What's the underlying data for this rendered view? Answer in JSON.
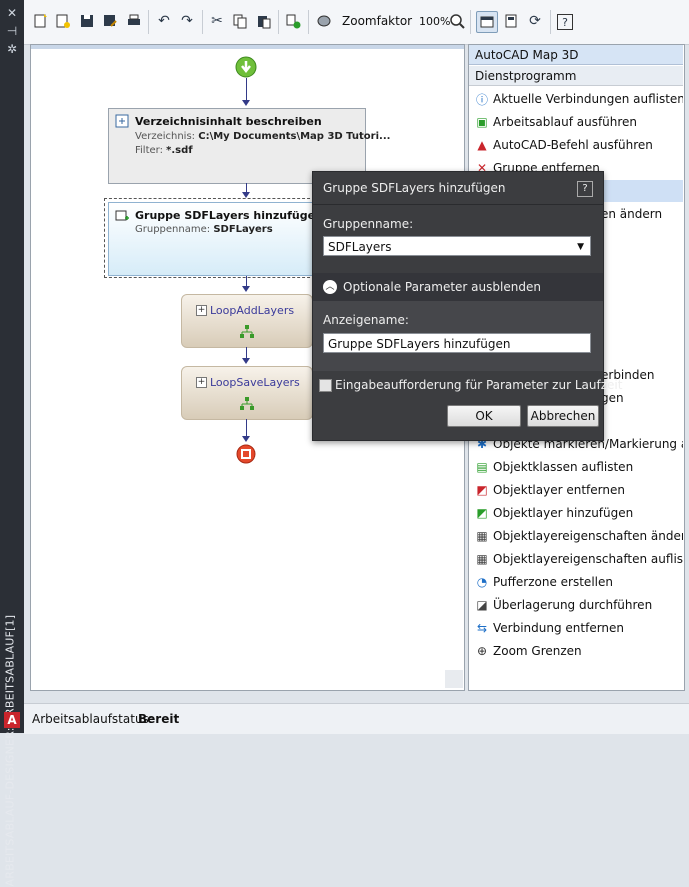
{
  "window": {
    "vertical_title": "ARBEITSABLAUF-DESIGNER: ARBEITSABLAUF[1]",
    "logo_letter": "A"
  },
  "toolbar": {
    "zoom_label": "Zoomfaktor",
    "zoom_value": "100%"
  },
  "canvas": {
    "activity1": {
      "title": "Verzeichnisinhalt beschreiben",
      "dir_label": "Verzeichnis:",
      "dir_value": "C:\\My Documents\\Map 3D Tutori...",
      "filter_label": "Filter:",
      "filter_value": "*.sdf"
    },
    "activity2": {
      "title": "Gruppe SDFLayers hinzufügen",
      "group_label": "Gruppenname:",
      "group_value": "SDFLayers"
    },
    "loop1": {
      "title": "LoopAddLayers"
    },
    "loop2": {
      "title": "LoopSaveLayers"
    }
  },
  "panel": {
    "header": "AutoCAD Map 3D",
    "subheader": "Dienstprogramm",
    "items": [
      {
        "label": "Aktuelle Verbindungen auflisten",
        "icon": "info-list-icon"
      },
      {
        "label": "Arbeitsablauf ausführen",
        "icon": "workflow-run-icon"
      },
      {
        "label": "AutoCAD-Befehl ausführen",
        "icon": "autocad-command-icon"
      },
      {
        "label": "Gruppe entfernen",
        "icon": "group-remove-icon"
      },
      {
        "label": "",
        "icon": "blank-icon"
      },
      {
        "label": "en ändern",
        "icon": "blank-icon"
      },
      {
        "label": "erbinden",
        "icon": "blank-icon"
      },
      {
        "label": "gen",
        "icon": "blank-icon"
      },
      {
        "label": "Objekte markieren/Markierung aufh",
        "icon": "mark-objects-icon"
      },
      {
        "label": "Objektklassen auflisten",
        "icon": "object-classes-icon"
      },
      {
        "label": "Objektlayer entfernen",
        "icon": "layer-remove-icon"
      },
      {
        "label": "Objektlayer hinzufügen",
        "icon": "layer-add-icon"
      },
      {
        "label": "Objektlayereigenschaften ändern",
        "icon": "layer-props-edit-icon"
      },
      {
        "label": "Objektlayereigenschaften auflisten",
        "icon": "layer-props-list-icon"
      },
      {
        "label": "Pufferzone erstellen",
        "icon": "buffer-icon"
      },
      {
        "label": "Überlagerung durchführen",
        "icon": "overlay-icon"
      },
      {
        "label": "Verbindung entfernen",
        "icon": "disconnect-icon"
      },
      {
        "label": "Zoom Grenzen",
        "icon": "zoom-extents-icon"
      }
    ]
  },
  "dialog": {
    "title": "Gruppe SDFLayers hinzufügen",
    "help": "?",
    "group_label": "Gruppenname:",
    "group_value": "SDFLayers",
    "collapse_label": "Optionale Parameter ausblenden",
    "display_label": "Anzeigename:",
    "display_value": "Gruppe SDFLayers hinzufügen",
    "prompt_label": "Eingabeaufforderung für Parameter zur Laufzeit",
    "ok_label": "OK",
    "cancel_label": "Abbrechen"
  },
  "status": {
    "label": "Arbeitsablaufstatus:",
    "value": "Bereit"
  }
}
